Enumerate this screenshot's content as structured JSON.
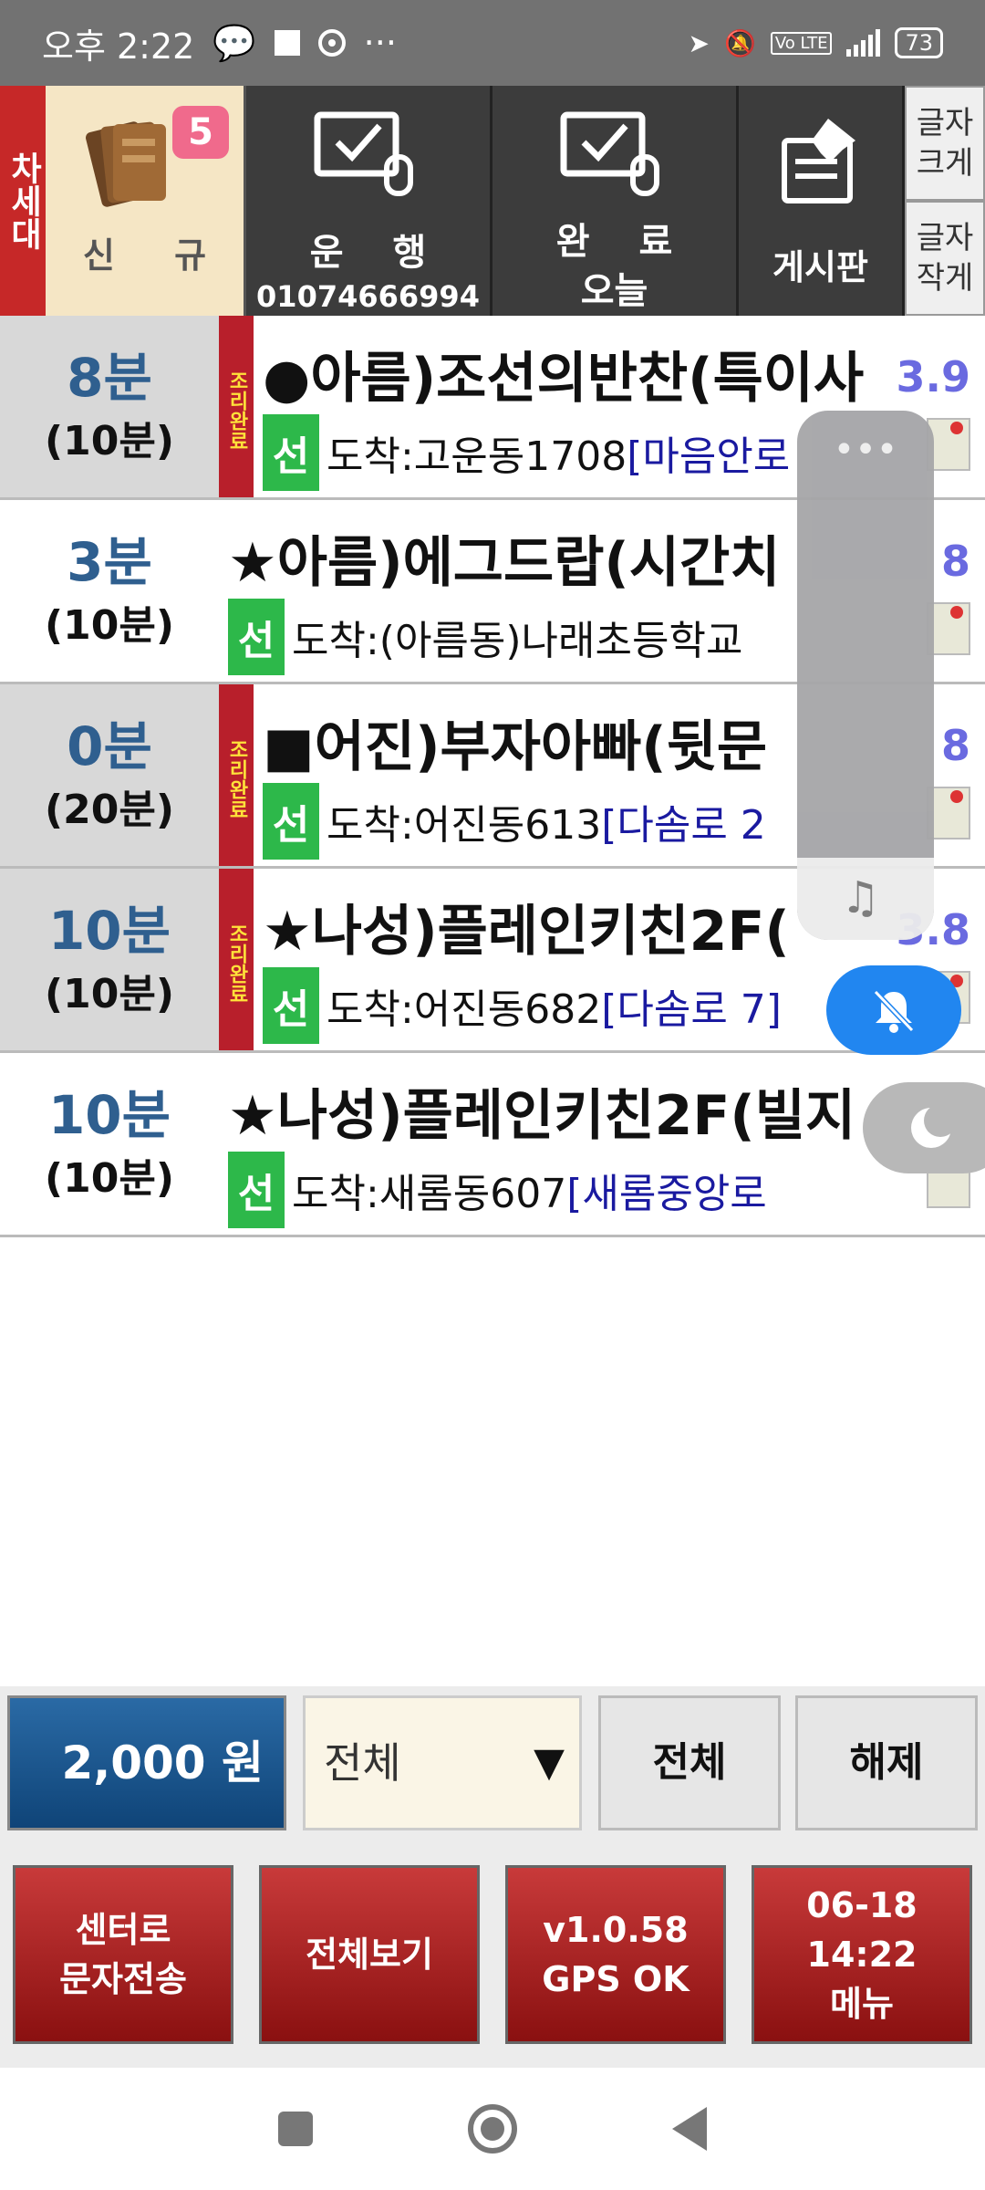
{
  "status": {
    "time": "오후 2:22",
    "battery": "73"
  },
  "toolbar": {
    "gen_label": "차세대",
    "new": {
      "label": "신 규",
      "badge": "5"
    },
    "run": {
      "label": "운 행",
      "phone": "01074666994"
    },
    "done": {
      "label": "완 료",
      "sub": "오늘"
    },
    "board": {
      "label": "게시판"
    },
    "font_big": "글자\n크게",
    "font_small": "글자\n작게"
  },
  "orders": [
    {
      "time": "8분",
      "sub": "(10분)",
      "cook": "조리완료",
      "name": "●아름)조선의반찬(특이사",
      "dist": "3.9",
      "sun": "선",
      "addr_prefix": "도착:고운동1708",
      "addr_road": "[마음안로"
    },
    {
      "time": "3분",
      "sub": "(10분)",
      "cook": "",
      "name": "★아름)에그드랍(시간치",
      "dist": "8",
      "sun": "선",
      "addr_prefix": "도착:(아름동)나래초등학교",
      "addr_road": ""
    },
    {
      "time": "0분",
      "sub": "(20분)",
      "cook": "조리완료",
      "name": "■어진)부자아빠(뒷문",
      "dist": "8",
      "sun": "선",
      "addr_prefix": "도착:어진동613",
      "addr_road": "[다솜로 2"
    },
    {
      "time": "10분",
      "sub": "(10분)",
      "cook": "조리완료",
      "name": "★나성)플레인키친2F(",
      "dist": "3.8",
      "sun": "선",
      "addr_prefix": "도착:어진동682",
      "addr_road": "[다솜로 7]"
    },
    {
      "time": "10분",
      "sub": "(10분)",
      "cook": "",
      "name": "★나성)플레인키친2F(빌지",
      "dist": "",
      "sun": "선",
      "addr_prefix": "도착:새롬동607",
      "addr_road": "[새롬중앙로"
    }
  ],
  "bottom": {
    "amount": "2,000 원",
    "filter": "전체",
    "select_all": "전체",
    "clear": "해제",
    "sms": "센터로\n문자전송",
    "view_all": "전체보기",
    "version": "v1.0.58\nGPS OK",
    "menu": "06-18 14:22\n메뉴"
  },
  "colors": {
    "accent_red": "#b81f2b",
    "blue": "#2186f0",
    "amount_blue": "#1a5590"
  }
}
